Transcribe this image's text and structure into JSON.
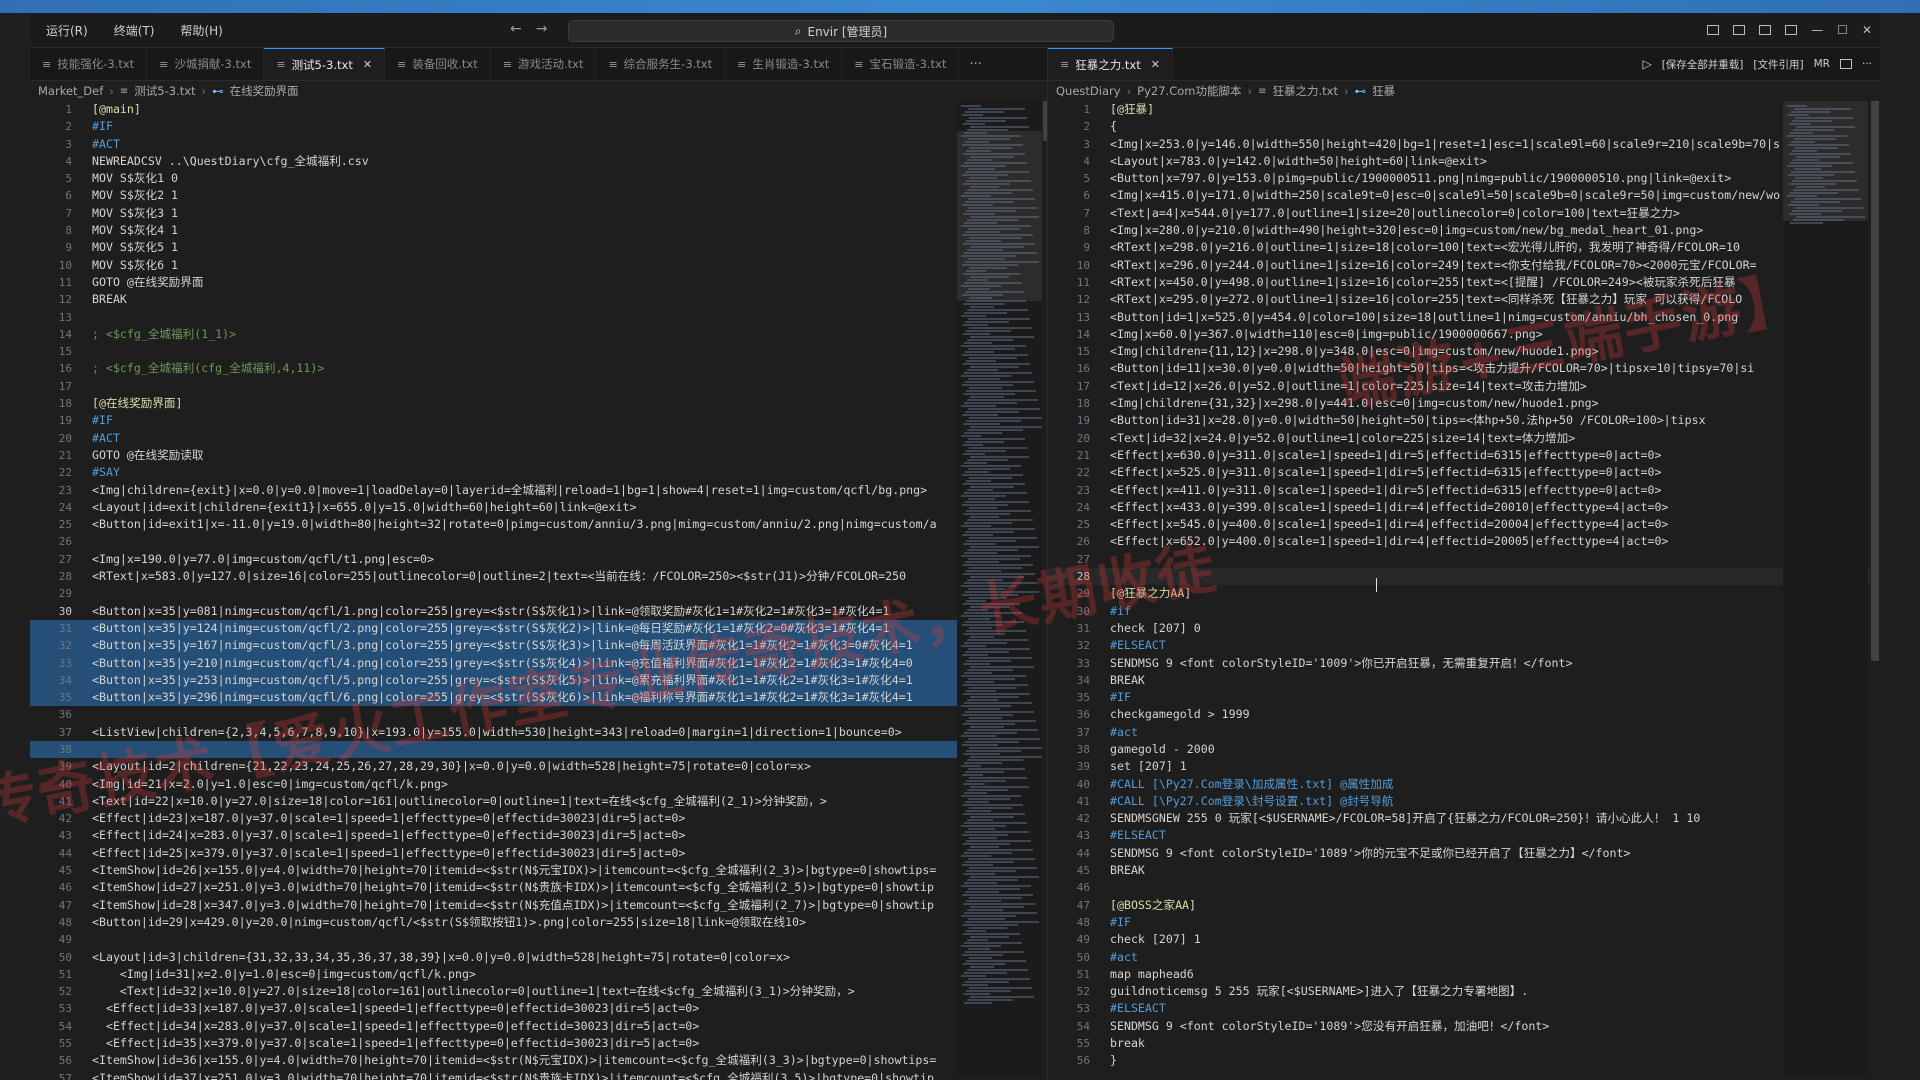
{
  "title_bar": {
    "menu": [
      "运行(R)",
      "终端(T)",
      "帮助(H)"
    ],
    "search": "Envir [管理员]"
  },
  "left": {
    "tabs": [
      {
        "label": "技能强化-3.txt",
        "active": false
      },
      {
        "label": "沙城捐献-3.txt",
        "active": false
      },
      {
        "label": "测试5-3.txt",
        "active": true
      },
      {
        "label": "装备回收.txt",
        "active": false
      },
      {
        "label": "游戏活动.txt",
        "active": false
      },
      {
        "label": "综合服务生-3.txt",
        "active": false
      },
      {
        "label": "生肖锻造-3.txt",
        "active": false
      },
      {
        "label": "宝石锻造-3.txt",
        "active": false
      }
    ],
    "more": "···",
    "breadcrumb": [
      "Market_Def",
      "测试5-3.txt",
      "在线奖励界面"
    ],
    "lines": [
      "[@main]",
      "#IF",
      "#ACT",
      "NEWREADCSV ..\\QuestDiary\\cfg_全城福利.csv",
      "MOV S$灰化1 0",
      "MOV S$灰化2 1",
      "MOV S$灰化3 1",
      "MOV S$灰化4 1",
      "MOV S$灰化5 1",
      "MOV S$灰化6 1",
      "GOTO @在线奖励界面",
      "BREAK",
      "",
      "; <$cfg_全城福利(1_1)>",
      "",
      "; <$cfg_全城福利(cfg_全城福利,4,11)>",
      "",
      "[@在线奖励界面]",
      "#IF",
      "#ACT",
      "GOTO @在线奖励读取",
      "#SAY",
      "<Img|children={exit}|x=0.0|y=0.0|move=1|loadDelay=0|layerid=全城福利|reload=1|bg=1|show=4|reset=1|img=custom/qcfl/bg.png>",
      "<Layout|id=exit|children={exit1}|x=655.0|y=15.0|width=60|height=60|link=@exit>",
      "<Button|id=exit1|x=-11.0|y=19.0|width=80|height=32|rotate=0|pimg=custom/anniu/3.png|mimg=custom/anniu/2.png|nimg=custom/a",
      "",
      "<Img|x=190.0|y=77.0|img=custom/qcfl/t1.png|esc=0>",
      "<RText|x=583.0|y=127.0|size=16|color=255|outlinecolor=0|outline=2|text=<当前在线：/FCOLOR=250><$str(J1)>分钟/FCOLOR=250",
      "",
      "<Button|x=35|y=081|nimg=custom/qcfl/1.png|color=255|grey=<$str(S$灰化1)>|link=@领取奖励#灰化1=1#灰化2=1#灰化3=1#灰化4=1",
      "<Button|x=35|y=124|nimg=custom/qcfl/2.png|color=255|grey=<$str(S$灰化2)>|link=@每日奖励#灰化1=1#灰化2=0#灰化3=1#灰化4=1",
      "<Button|x=35|y=167|nimg=custom/qcfl/3.png|color=255|grey=<$str(S$灰化3)>|link=@每周活跃界面#灰化1=1#灰化2=1#灰化3=0#灰化4=1",
      "<Button|x=35|y=210|nimg=custom/qcfl/4.png|color=255|grey=<$str(S$灰化4)>|link=@充值福利界面#灰化1=1#灰化2=1#灰化3=1#灰化4=0",
      "<Button|x=35|y=253|nimg=custom/qcfl/5.png|color=255|grey=<$str(S$灰化5)>|link=@累充福利界面#灰化1=1#灰化2=1#灰化3=1#灰化4=1",
      "<Button|x=35|y=296|nimg=custom/qcfl/6.png|color=255|grey=<$str(S$灰化6)>|link=@福利称号界面#灰化1=1#灰化2=1#灰化3=1#灰化4=1",
      "",
      "<ListView|children={2,3,4,5,6,7,8,9,10}|x=193.0|y=155.0|width=530|height=343|reload=0|margin=1|direction=1|bounce=0>",
      "",
      "<Layout|id=2|children={21,22,23,24,25,26,27,28,29,30}|x=0.0|y=0.0|width=528|height=75|rotate=0|color=x>",
      "<Img|id=21|x=2.0|y=1.0|esc=0|img=custom/qcfl/k.png>",
      "<Text|id=22|x=10.0|y=27.0|size=18|color=161|outlinecolor=0|outline=1|text=在线<$cfg_全城福利(2_1)>分钟奖励，>",
      "<Effect|id=23|x=187.0|y=37.0|scale=1|speed=1|effecttype=0|effectid=30023|dir=5|act=0>",
      "<Effect|id=24|x=283.0|y=37.0|scale=1|speed=1|effecttype=0|effectid=30023|dir=5|act=0>",
      "<Effect|id=25|x=379.0|y=37.0|scale=1|speed=1|effecttype=0|effectid=30023|dir=5|act=0>",
      "<ItemShow|id=26|x=155.0|y=4.0|width=70|height=70|itemid=<$str(N$元宝IDX)>|itemcount=<$cfg_全城福利(2_3)>|bgtype=0|showtips=",
      "<ItemShow|id=27|x=251.0|y=3.0|width=70|height=70|itemid=<$str(N$贵族卡IDX)>|itemcount=<$cfg_全城福利(2_5)>|bgtype=0|showtip",
      "<ItemShow|id=28|x=347.0|y=3.0|width=70|height=70|itemid=<$str(N$充值点IDX)>|itemcount=<$cfg_全城福利(2_7)>|bgtype=0|showtip",
      "<Button|id=29|x=429.0|y=20.0|nimg=custom/qcfl/<$str(S$领取按钮1)>.png|color=255|size=18|link=@领取在线10>",
      "",
      "<Layout|id=3|children={31,32,33,34,35,36,37,38,39}|x=0.0|y=0.0|width=528|height=75|rotate=0|color=x>",
      "    <Img|id=31|x=2.0|y=1.0|esc=0|img=custom/qcfl/k.png>",
      "    <Text|id=32|x=10.0|y=27.0|size=18|color=161|outlinecolor=0|outline=1|text=在线<$cfg_全城福利(3_1)>分钟奖励，>",
      "  <Effect|id=33|x=187.0|y=37.0|scale=1|speed=1|effecttype=0|effectid=30023|dir=5|act=0>",
      "  <Effect|id=34|x=283.0|y=37.0|scale=1|speed=1|effecttype=0|effectid=30023|dir=5|act=0>",
      "  <Effect|id=35|x=379.0|y=37.0|scale=1|speed=1|effecttype=0|effectid=30023|dir=5|act=0>",
      "<ItemShow|id=36|x=155.0|y=4.0|width=70|height=70|itemid=<$str(N$元宝IDX)>|itemcount=<$cfg_全城福利(3_3)>|bgtype=0|showtips=",
      "<ItemShow|id=37|x=251.0|y=3.0|width=70|height=70|itemid=<$str(N$贵族卡IDX)>|itemcount=<$cfg_全城福利(3_5)>|bgtype=0|showtip"
    ]
  },
  "right": {
    "tab": "狂暴之力.txt",
    "actions": [
      "保存全部并重载",
      "文件引用",
      "MR"
    ],
    "breadcrumb": [
      "QuestDiary",
      "Py27.Com功能脚本",
      "狂暴之力.txt",
      "狂暴"
    ],
    "lines": [
      "[@狂暴]",
      "{",
      "<Img|x=253.0|y=146.0|width=550|height=420|bg=1|reset=1|esc=1|scale9l=60|scale9r=210|scale9b=70|s",
      "<Layout|x=783.0|y=142.0|width=50|height=60|link=@exit>",
      "<Button|x=797.0|y=153.0|pimg=public/1900000511.png|nimg=public/1900000510.png|link=@exit>",
      "<Img|x=415.0|y=171.0|width=250|scale9t=0|esc=0|scale9l=50|scale9b=0|scale9r=50|img=custom/new/wo",
      "<Text|a=4|x=544.0|y=177.0|outline=1|size=20|outlinecolor=0|color=100|text=狂暴之力>",
      "<Img|x=280.0|y=210.0|width=490|height=320|esc=0|img=custom/new/bg_medal_heart_01.png>",
      "<RText|x=298.0|y=216.0|outline=1|size=18|color=100|text=<宏光得儿肝的，我发明了神奇得/FCOLOR=10",
      "<RText|x=296.0|y=244.0|outline=1|size=16|color=249|text=<你支付给我/FCOLOR=70><2000元宝/FCOLOR=",
      "<RText|x=450.0|y=498.0|outline=1|size=16|color=255|text=<[提醒] /FCOLOR=249><被玩家杀死后狂暴",
      "<RText|x=295.0|y=272.0|outline=1|size=16|color=255|text=<同样杀死【狂暴之力】玩家 可以获得/FCOLO",
      "<Button|id=1|x=525.0|y=454.0|color=100|size=18|outline=1|nimg=custom/anniu/bh_chosen_0.png",
      "<Img|x=60.0|y=367.0|width=110|esc=0|img=public/1900000667.png>",
      "<Img|children={11,12}|x=298.0|y=348.0|esc=0|img=custom/new/huode1.png>",
      "<Button|id=11|x=30.0|y=0.0|width=50|height=50|tips=<攻击力提升/FCOLOR=70>|tipsx=10|tipsy=70|si",
      "<Text|id=12|x=26.0|y=52.0|outline=1|color=225|size=14|text=攻击力增加>",
      "<Img|children={31,32}|x=298.0|y=441.0|esc=0|img=custom/new/huode1.png>",
      "<Button|id=31|x=28.0|y=0.0|width=50|height=50|tips=<体hp+50.法hp+50 /FCOLOR=100>|tipsx",
      "<Text|id=32|x=24.0|y=52.0|outline=1|color=225|size=14|text=体力增加>",
      "<Effect|x=630.0|y=311.0|scale=1|speed=1|dir=5|effectid=6315|effecttype=0|act=0>",
      "<Effect|x=525.0|y=311.0|scale=1|speed=1|dir=5|effectid=6315|effecttype=0|act=0>",
      "<Effect|x=411.0|y=311.0|scale=1|speed=1|dir=5|effectid=6315|effecttype=0|act=0>",
      "<Effect|x=433.0|y=399.0|scale=1|speed=1|dir=4|effectid=20010|effecttype=4|act=0>",
      "<Effect|x=545.0|y=400.0|scale=1|speed=1|dir=4|effectid=20004|effecttype=4|act=0>",
      "<Effect|x=652.0|y=400.0|scale=1|speed=1|dir=4|effectid=20005|effecttype=4|act=0>",
      "",
      "",
      "[@狂暴之力AA]",
      "#if",
      "check [207] 0",
      "#ELSEACT",
      "SENDMSG 9 <font colorStyleID='1009'>你已开启狂暴，无需重复开启！</font>",
      "BREAK",
      "#IF",
      "checkgamegold > 1999",
      "#act",
      "gamegold - 2000",
      "set [207] 1",
      "#CALL [\\Py27.Com登录\\加成属性.txt] @属性加成",
      "#CALL [\\Py27.Com登录\\封号设置.txt] @封号导航",
      "SENDMSGNEW 255 0 玩家[<$USERNAME>/FCOLOR=58]开启了{狂暴之力/FCOLOR=250}！请小心此人！ 1 10",
      "#ELSEACT",
      "SENDMSG 9 <font colorStyleID='1089'>你的元宝不足或你已经开启了【狂暴之力】</font>",
      "BREAK",
      "",
      "[@BOSS之家AA]",
      "#IF",
      "check [207] 1",
      "#act",
      "map maphead6",
      "guildnoticemsg 5 255 玩家[<$USERNAME>]进入了【狂暴之力专署地图】.",
      "#ELSEACT",
      "SENDMSG 9 <font colorStyleID='1089'>您没有开启狂暴，加油吧！</font>",
      "break",
      "}"
    ]
  },
  "watermarks": [
    "传奇技术【爱火工作室专业传奇技术，长期收徒",
    "端游+三端手游】"
  ]
}
